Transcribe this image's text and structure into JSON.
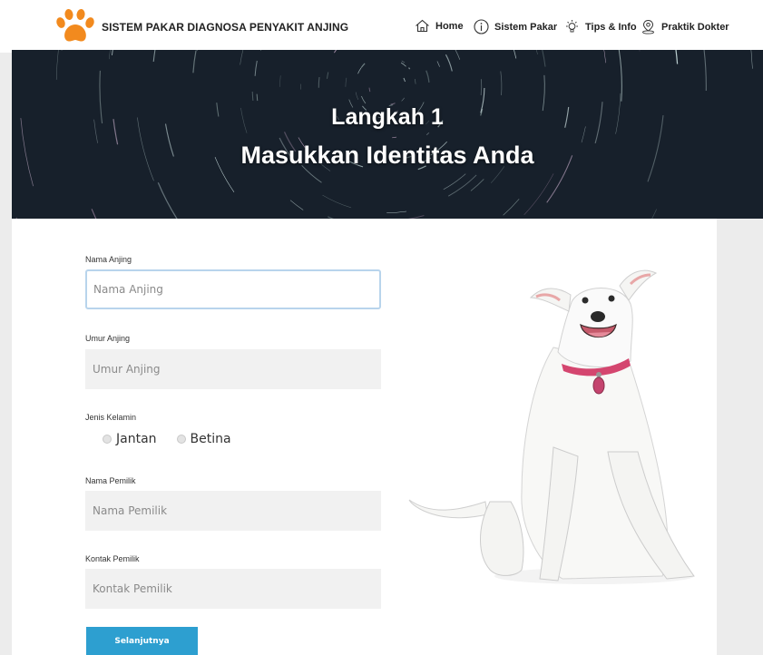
{
  "header": {
    "brand": "SISTEM PAKAR DIAGNOSA PENYAKIT ANJING",
    "logo_icon": "paw-icon",
    "nav": [
      {
        "label": "Home",
        "icon": "home-icon"
      },
      {
        "label": "Sistem Pakar",
        "icon": "info-icon"
      },
      {
        "label": "Tips & Info",
        "icon": "lightbulb-icon"
      },
      {
        "label": "Praktik Dokter",
        "icon": "location-pin-icon"
      }
    ]
  },
  "hero": {
    "line1": "Langkah 1",
    "line2": "Masukkan Identitas Anda"
  },
  "form": {
    "dog_name": {
      "label": "Nama Anjing",
      "placeholder": "Nama Anjing",
      "value": ""
    },
    "dog_age": {
      "label": "Umur Anjing",
      "placeholder": "Umur Anjing",
      "value": ""
    },
    "gender": {
      "label": "Jenis Kelamin",
      "options": [
        "Jantan",
        "Betina"
      ],
      "selected": null
    },
    "owner_name": {
      "label": "Nama Pemilik",
      "placeholder": "Nama Pemilik",
      "value": ""
    },
    "owner_contact": {
      "label": "Kontak Pemilik",
      "placeholder": "Kontak Pemilik",
      "value": ""
    },
    "submit_label": "Selanjutnya"
  },
  "colors": {
    "accent": "#2d9fd0",
    "paw": "#f28a1e",
    "hero_bg": "#17202b",
    "focus_border": "#b8d4ec"
  }
}
